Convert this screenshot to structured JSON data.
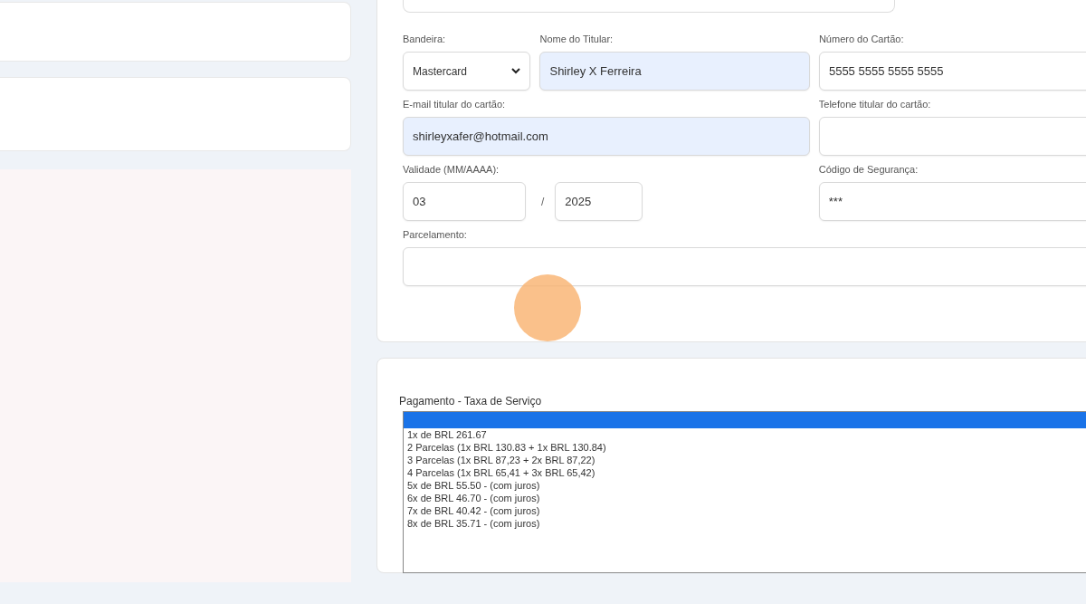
{
  "card_form": {
    "top_field": {
      "visible": true
    },
    "fields_row_1": [
      {
        "kind": "select",
        "label": "Bandeira:",
        "value": "Mastercard",
        "autofilled": false
      },
      {
        "kind": "text",
        "label": "Nome do Titular:",
        "value": "Shirley X Ferreira",
        "autofilled": true
      },
      {
        "kind": "text",
        "label": "Número do Cartão:",
        "value": "5555 5555 5555 5555",
        "autofilled": false
      }
    ],
    "fields_row_2": [
      {
        "kind": "text",
        "label": "E-mail titular do cartão:",
        "value": "shirleyxafer@hotmail.com",
        "autofilled": true
      },
      {
        "kind": "text",
        "label": "Telefone titular do cartão:",
        "autofilled": false
      }
    ],
    "validity": {
      "label": "Validade (MM/AAAA):",
      "month": "03",
      "separator": "/",
      "year": "2025"
    },
    "security_code": {
      "label": "Código de Segurança:",
      "value": "***"
    },
    "installments": {
      "label": "Parcelamento:"
    }
  },
  "payment_card": {
    "heading": "Pagamento - Taxa de Serviço",
    "dropdown": {
      "blank_option_highlighted": true,
      "options": [
        {
          "label": "1x de BRL 261.67",
          "selected": false
        },
        {
          "label": "2 Parcelas (1x BRL 130.83 + 1x BRL 130.84)",
          "selected": false
        },
        {
          "label": "3 Parcelas (1x BRL 87,23 + 2x BRL 87,22)",
          "selected": false
        },
        {
          "label": "4 Parcelas (1x BRL 65,41 + 3x BRL 65,42)",
          "selected": false
        },
        {
          "label": "5x de BRL 55.50 - (com juros)",
          "selected": false
        },
        {
          "label": "6x de BRL 46.70 - (com juros)",
          "selected": false
        },
        {
          "label": "7x de BRL 40.42 - (com juros)",
          "selected": false
        },
        {
          "label": "8x de BRL 35.71 - (com juros)",
          "selected": false
        }
      ]
    }
  },
  "click_marker": {
    "visible": true
  }
}
